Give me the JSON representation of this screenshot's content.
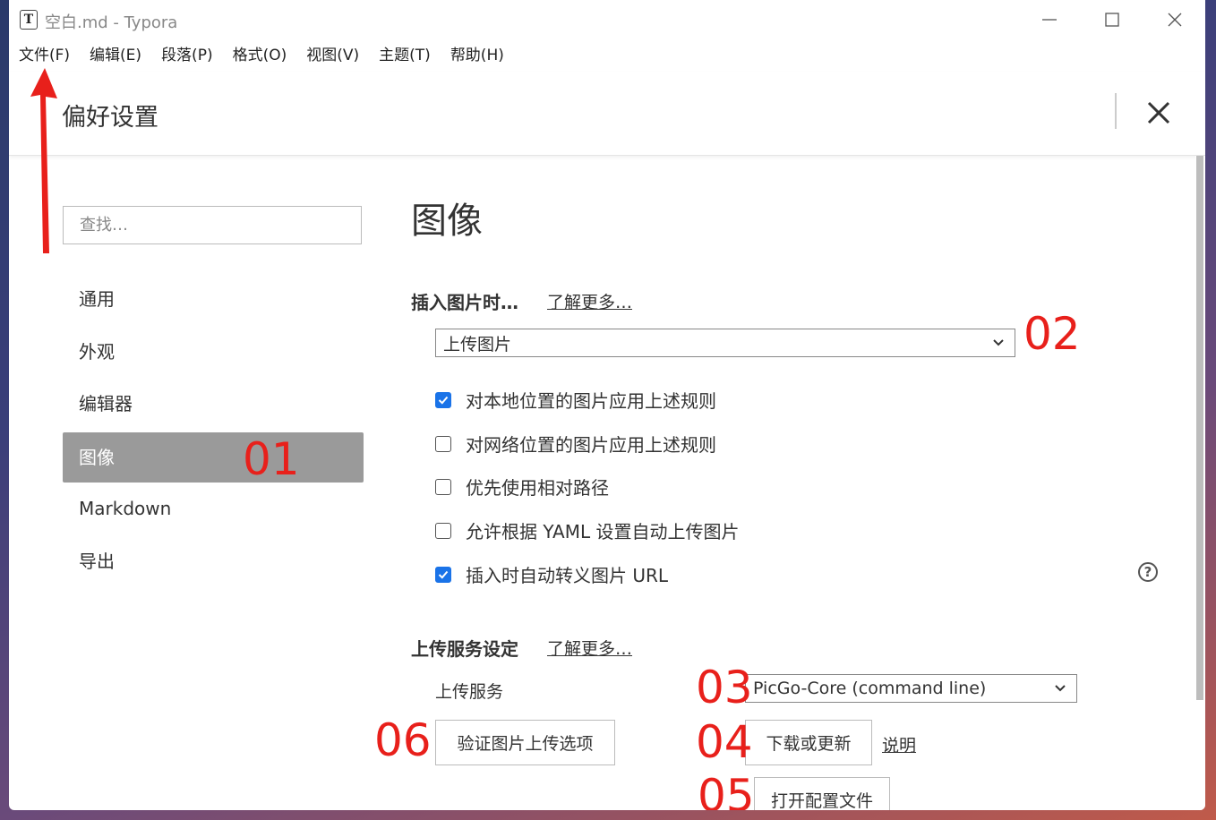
{
  "window": {
    "app_icon": "T",
    "title": "空白.md - Typora"
  },
  "menu": [
    "文件(F)",
    "编辑(E)",
    "段落(P)",
    "格式(O)",
    "视图(V)",
    "主题(T)",
    "帮助(H)"
  ],
  "prefs": {
    "title": "偏好设置"
  },
  "sidebar": {
    "search_placeholder": "查找…",
    "items": [
      {
        "label": "通用"
      },
      {
        "label": "外观"
      },
      {
        "label": "编辑器"
      },
      {
        "label": "图像",
        "active": true
      },
      {
        "label": "Markdown"
      },
      {
        "label": "导出"
      }
    ]
  },
  "main": {
    "section_title": "图像",
    "insert": {
      "title": "插入图片时…",
      "learn_more": "了解更多…",
      "select_value": "上传图片",
      "options": [
        {
          "label": "对本地位置的图片应用上述规则",
          "checked": true
        },
        {
          "label": "对网络位置的图片应用上述规则",
          "checked": false
        },
        {
          "label": "优先使用相对路径",
          "checked": false
        },
        {
          "label": "允许根据 YAML 设置自动上传图片",
          "checked": false
        },
        {
          "label": "插入时自动转义图片 URL",
          "checked": true
        }
      ],
      "help": "?"
    },
    "upload": {
      "title": "上传服务设定",
      "learn_more": "了解更多…",
      "service_label": "上传服务",
      "service_value": "PicGo-Core (command line)",
      "verify_button": "验证图片上传选项",
      "download_button": "下载或更新",
      "explain_link": "说明",
      "open_config_button": "打开配置文件"
    }
  },
  "annotations": {
    "n01": "01",
    "n02": "02",
    "n03": "03",
    "n04": "04",
    "n05": "05",
    "n06": "06"
  },
  "colors": {
    "annotation": "#e8201b",
    "active_nav": "#9a9a9a",
    "checkbox_on": "#1a73e8"
  }
}
